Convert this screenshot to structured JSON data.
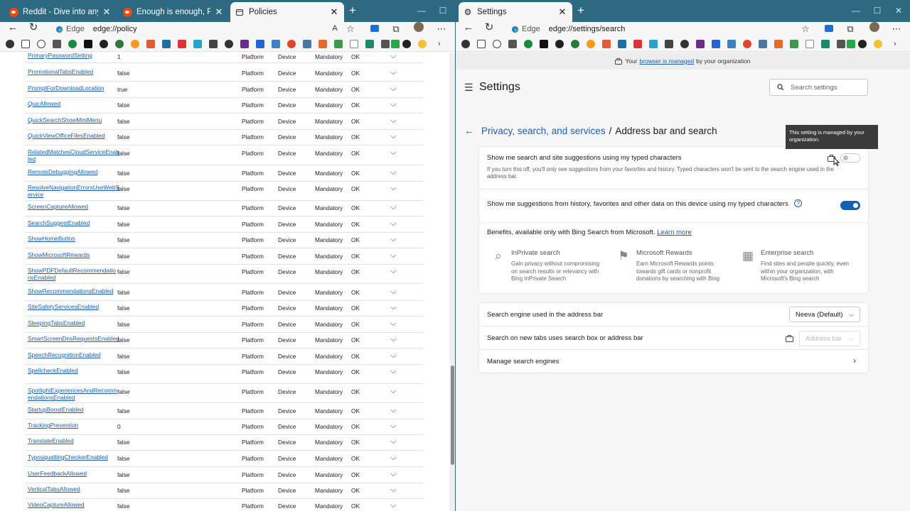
{
  "left_window": {
    "tabs": [
      {
        "title": "Reddit - Dive into anything",
        "favicon": "reddit-icon",
        "active": false
      },
      {
        "title": "Enough is enough, PT II : Microsof",
        "favicon": "reddit-icon",
        "active": false
      },
      {
        "title": "Policies",
        "favicon": "page-icon",
        "active": true
      }
    ],
    "address": {
      "browser_label": "Edge",
      "url": "edge://policy"
    },
    "policies": [
      {
        "name": "PrimaryPasswordSetting",
        "value": "1",
        "source": "Platform",
        "scope": "Device",
        "level": "Mandatory",
        "status": "OK"
      },
      {
        "name": "PromotionalTabsEnabled",
        "value": "false",
        "source": "Platform",
        "scope": "Device",
        "level": "Mandatory",
        "status": "OK"
      },
      {
        "name": "PromptForDownloadLocation",
        "value": "true",
        "source": "Platform",
        "scope": "Device",
        "level": "Mandatory",
        "status": "OK"
      },
      {
        "name": "QuicAllowed",
        "value": "false",
        "source": "Platform",
        "scope": "Device",
        "level": "Mandatory",
        "status": "OK"
      },
      {
        "name": "QuickSearchShowMiniMenu",
        "value": "false",
        "source": "Platform",
        "scope": "Device",
        "level": "Mandatory",
        "status": "OK"
      },
      {
        "name": "QuickViewOfficeFilesEnabled",
        "value": "false",
        "source": "Platform",
        "scope": "Device",
        "level": "Mandatory",
        "status": "OK"
      },
      {
        "name": "RelatedMatchesCloudServiceEnab led",
        "value": "false",
        "source": "Platform",
        "scope": "Device",
        "level": "Mandatory",
        "status": "OK"
      },
      {
        "name": "RemoteDebuggingAllowed",
        "value": "false",
        "source": "Platform",
        "scope": "Device",
        "level": "Mandatory",
        "status": "OK"
      },
      {
        "name": "ResolveNavigationErrorsUseWebS ervice",
        "value": "false",
        "source": "Platform",
        "scope": "Device",
        "level": "Mandatory",
        "status": "OK"
      },
      {
        "name": "ScreenCaptureAllowed",
        "value": "false",
        "source": "Platform",
        "scope": "Device",
        "level": "Mandatory",
        "status": "OK"
      },
      {
        "name": "SearchSuggestEnabled",
        "value": "false",
        "source": "Platform",
        "scope": "Device",
        "level": "Mandatory",
        "status": "OK"
      },
      {
        "name": "ShowHomeButton",
        "value": "false",
        "source": "Platform",
        "scope": "Device",
        "level": "Mandatory",
        "status": "OK"
      },
      {
        "name": "ShowMicrosoftRewards",
        "value": "false",
        "source": "Platform",
        "scope": "Device",
        "level": "Mandatory",
        "status": "OK"
      },
      {
        "name": "ShowPDFDefaultRecommendatio nsEnabled",
        "value": "false",
        "source": "Platform",
        "scope": "Device",
        "level": "Mandatory",
        "status": "OK"
      },
      {
        "name": "ShowRecommendationsEnabled",
        "value": "false",
        "source": "Platform",
        "scope": "Device",
        "level": "Mandatory",
        "status": "OK"
      },
      {
        "name": "SiteSafetyServicesEnabled",
        "value": "false",
        "source": "Platform",
        "scope": "Device",
        "level": "Mandatory",
        "status": "OK"
      },
      {
        "name": "SleepingTabsEnabled",
        "value": "false",
        "source": "Platform",
        "scope": "Device",
        "level": "Mandatory",
        "status": "OK"
      },
      {
        "name": "SmartScreenDnsRequestsEnabled",
        "value": "false",
        "source": "Platform",
        "scope": "Device",
        "level": "Mandatory",
        "status": "OK"
      },
      {
        "name": "SpeechRecognitionEnabled",
        "value": "false",
        "source": "Platform",
        "scope": "Device",
        "level": "Mandatory",
        "status": "OK"
      },
      {
        "name": "SpellcheckEnabled",
        "value": "false",
        "source": "Platform",
        "scope": "Device",
        "level": "Mandatory",
        "status": "OK"
      },
      {
        "name": "SpotlightExperiencesAndRecomm endationsEnabled",
        "value": "false",
        "source": "Platform",
        "scope": "Device",
        "level": "Mandatory",
        "status": "OK"
      },
      {
        "name": "StartupBoostEnabled",
        "value": "false",
        "source": "Platform",
        "scope": "Device",
        "level": "Mandatory",
        "status": "OK"
      },
      {
        "name": "TrackingPrevention",
        "value": "0",
        "source": "Platform",
        "scope": "Device",
        "level": "Mandatory",
        "status": "OK"
      },
      {
        "name": "TranslateEnabled",
        "value": "false",
        "source": "Platform",
        "scope": "Device",
        "level": "Mandatory",
        "status": "OK"
      },
      {
        "name": "TyposquattingCheckerEnabled",
        "value": "false",
        "source": "Platform",
        "scope": "Device",
        "level": "Mandatory",
        "status": "OK"
      },
      {
        "name": "UserFeedbackAllowed",
        "value": "false",
        "source": "Platform",
        "scope": "Device",
        "level": "Mandatory",
        "status": "OK"
      },
      {
        "name": "VerticalTabsAllowed",
        "value": "false",
        "source": "Platform",
        "scope": "Device",
        "level": "Mandatory",
        "status": "OK"
      },
      {
        "name": "VideoCaptureAllowed",
        "value": "false",
        "source": "Platform",
        "scope": "Device",
        "level": "Mandatory",
        "status": "OK"
      }
    ]
  },
  "right_window": {
    "tab": {
      "title": "Settings",
      "favicon": "gear-icon"
    },
    "address": {
      "browser_label": "Edge",
      "url": "edge://settings/search"
    },
    "managed_bar": {
      "prefix": "Your",
      "link": "browser is managed",
      "suffix": "by your organization"
    },
    "settings_title": "Settings",
    "search_placeholder": "Search settings",
    "breadcrumb": {
      "parent": "Privacy, search, and services",
      "separator": "/",
      "current": "Address bar and search"
    },
    "tooltip": "This setting is managed by your organization.",
    "suggestions": {
      "typed_title": "Show me search and site suggestions using my typed characters",
      "typed_desc": "If you turn this off, you'll only see suggestions from your favorites and history. Typed characters won't be sent to the search engine used in the address bar.",
      "typed_enabled": false,
      "history_title": "Show me suggestions from history, favorites and other data on this device using my typed characters",
      "history_enabled": true
    },
    "benefits": {
      "heading": "Benefits, available only with Bing Search from Microsoft.",
      "learn_more": "Learn more",
      "items": [
        {
          "title": "InPrivate search",
          "desc": "Gain privacy without compromising on search results or relevancy with Bing InPrivate Search"
        },
        {
          "title": "Microsoft Rewards",
          "desc": "Earn Microsoft Rewards points towards gift cards or nonprofit donations by searching with Bing"
        },
        {
          "title": "Enterprise search",
          "desc": "Find sites and people quickly, even within your organization, with Microsoft's Bing search"
        }
      ]
    },
    "engine": {
      "label": "Search engine used in the address bar",
      "value": "Neeva (Default)",
      "newtab_label": "Search on new tabs uses search box or address bar",
      "newtab_value": "Address bar",
      "manage_label": "Manage search engines"
    }
  },
  "colors": {
    "titlebar": "#2d6a82",
    "link": "#1a5db3",
    "toggle_on": "#0f62b5"
  }
}
